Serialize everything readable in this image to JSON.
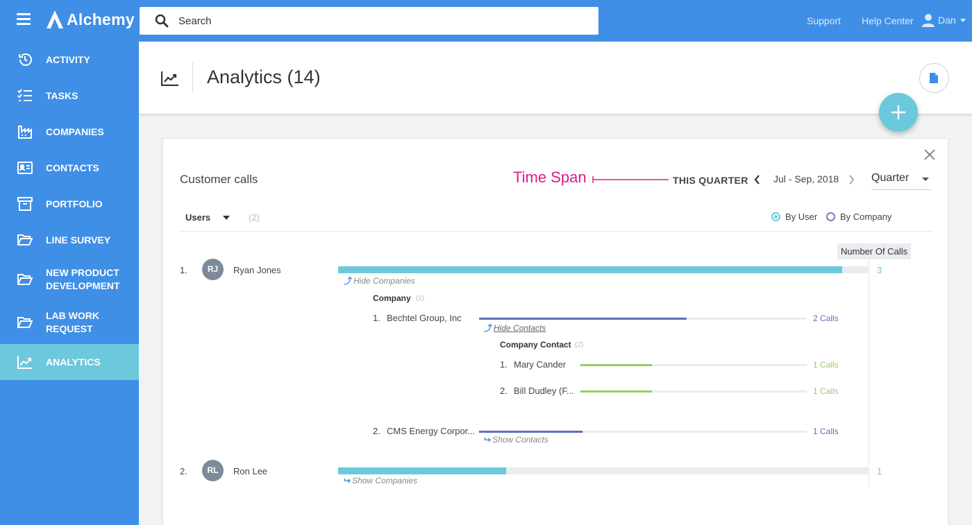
{
  "app": {
    "brand": "Alchemy",
    "search_placeholder": "Search",
    "links": {
      "support": "Support",
      "help_center": "Help Center"
    },
    "user": "Dan"
  },
  "sidebar": {
    "items": [
      {
        "label": "ACTIVITY",
        "icon": "history-icon"
      },
      {
        "label": "TASKS",
        "icon": "checklist-icon"
      },
      {
        "label": "COMPANIES",
        "icon": "factory-icon"
      },
      {
        "label": "CONTACTS",
        "icon": "contact-card-icon"
      },
      {
        "label": "PORTFOLIO",
        "icon": "archive-box-icon"
      },
      {
        "label": "LINE SURVEY",
        "icon": "folder-open-icon"
      },
      {
        "label": "NEW PRODUCT DEVELOPMENT",
        "icon": "folder-open-icon"
      },
      {
        "label": "LAB WORK REQUEST",
        "icon": "folder-open-icon"
      },
      {
        "label": "ANALYTICS",
        "icon": "trending-chart-icon",
        "active": true
      }
    ]
  },
  "header": {
    "title": "Analytics (14)"
  },
  "card": {
    "title": "Customer calls",
    "annotation": "Time Span",
    "period_label": "THIS QUARTER",
    "date_range": "Jul - Sep, 2018",
    "period_select": "Quarter",
    "group_filter": {
      "label": "Users",
      "count": "(2)"
    },
    "view_options": [
      {
        "label": "By User",
        "selected": true
      },
      {
        "label": "By Company",
        "selected": false
      }
    ],
    "metric_label": "Number Of Calls"
  },
  "users": [
    {
      "num": "1.",
      "initials": "RJ",
      "name": "Ryan Jones",
      "calls": 3,
      "total": "3",
      "toggle": "Hide Companies",
      "companies_header": "Company",
      "companies_count": "(2)",
      "companies": [
        {
          "num": "1.",
          "name": "Bechtel Group, Inc",
          "calls": 2,
          "calls_label": "2 Calls",
          "toggle": "Hide Contacts",
          "contacts_header": "Company Contact",
          "contacts_count": "(2)",
          "contacts": [
            {
              "num": "1.",
              "name": "Mary Cander",
              "calls": 1,
              "calls_label": "1 Calls"
            },
            {
              "num": "2.",
              "name": "Bill Dudley (F...",
              "calls": 1,
              "calls_label": "1 Calls"
            }
          ]
        },
        {
          "num": "2.",
          "name": "CMS Energy Corpor...",
          "calls": 1,
          "calls_label": "1 Calls",
          "toggle": "Show Contacts"
        }
      ]
    },
    {
      "num": "2.",
      "initials": "RL",
      "name": "Ron Lee",
      "calls": 1,
      "total": "1",
      "toggle": "Show Companies"
    }
  ],
  "colors": {
    "primary": "#3f8fe6",
    "accent": "#6cc8dc",
    "company_bar": "#5a6ebd",
    "contact_bar": "#9ccc65",
    "annotation": "#e0198a"
  }
}
